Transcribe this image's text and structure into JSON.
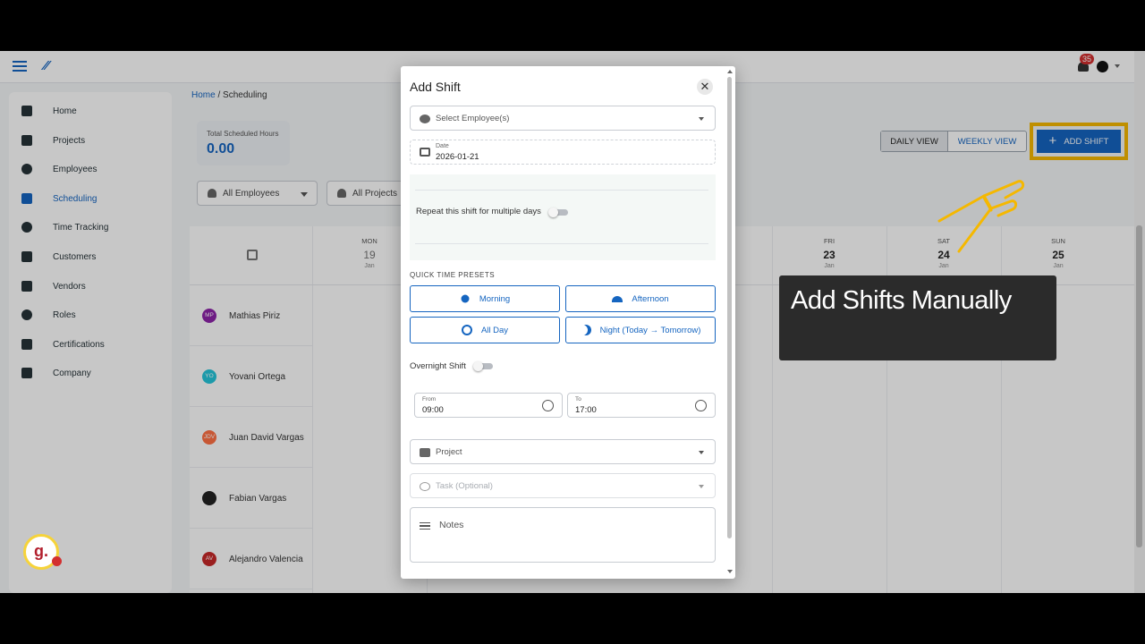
{
  "brand": {
    "accent": "#1565c0",
    "highlight": "#f5b800"
  },
  "topbar": {
    "notification_count": "35"
  },
  "sidebar": {
    "items": [
      {
        "label": "Home",
        "icon": "home-icon"
      },
      {
        "label": "Projects",
        "icon": "dashboard-icon"
      },
      {
        "label": "Employees",
        "icon": "people-icon"
      },
      {
        "label": "Scheduling",
        "icon": "calendar-icon",
        "active": true
      },
      {
        "label": "Time Tracking",
        "icon": "history-icon"
      },
      {
        "label": "Customers",
        "icon": "briefcase-icon"
      },
      {
        "label": "Vendors",
        "icon": "toolbox-icon"
      },
      {
        "label": "Roles",
        "icon": "shield-icon"
      },
      {
        "label": "Certifications",
        "icon": "badge-icon"
      },
      {
        "label": "Company",
        "icon": "building-icon"
      }
    ]
  },
  "breadcrumb": {
    "home": "Home",
    "sep": "/",
    "current": "Scheduling"
  },
  "stats": {
    "total_label": "Total Scheduled Hours",
    "total_value": "0.00"
  },
  "filters": {
    "employees": "All Employees",
    "projects": "All Projects"
  },
  "views": {
    "daily": "DAILY VIEW",
    "weekly": "WEEKLY VIEW"
  },
  "add_shift_label": "ADD SHIFT",
  "calendar": {
    "days": [
      {
        "name": "MON",
        "date": "19",
        "month": "Jan"
      },
      {
        "name": "FRI",
        "date": "23",
        "month": "Jan"
      },
      {
        "name": "SAT",
        "date": "24",
        "month": "Jan"
      },
      {
        "name": "SUN",
        "date": "25",
        "month": "Jan"
      }
    ],
    "employees": [
      {
        "initials": "MP",
        "name": "Mathias Piriz",
        "color": "#8e24aa"
      },
      {
        "initials": "YO",
        "name": "Yovani Ortega",
        "color": "#26c6da"
      },
      {
        "initials": "JDV",
        "name": "Juan David Vargas",
        "color": "#ff7043"
      },
      {
        "initials": "",
        "name": "Fabian Vargas",
        "color": "#222222"
      },
      {
        "initials": "AV",
        "name": "Alejandro Valencia",
        "color": "#c62828"
      }
    ]
  },
  "modal": {
    "title": "Add Shift",
    "close": "✕",
    "employee_placeholder": "Select Employee(s)",
    "date_label": "Date",
    "date_value": "2026-01-21",
    "repeat_label": "Repeat this shift for multiple days",
    "presets_label": "QUICK TIME PRESETS",
    "presets": [
      "Morning",
      "Afternoon",
      "All Day",
      "Night (Today → Tomorrow)"
    ],
    "overnight_label": "Overnight Shift",
    "from_label": "From",
    "from_value": "09:00",
    "to_label": "To",
    "to_value": "17:00",
    "project_placeholder": "Project",
    "task_placeholder": "Task (Optional)",
    "notes_placeholder": "Notes"
  },
  "callout": {
    "text": "Add Shifts Manually"
  },
  "watermark": {
    "letter": "g."
  }
}
